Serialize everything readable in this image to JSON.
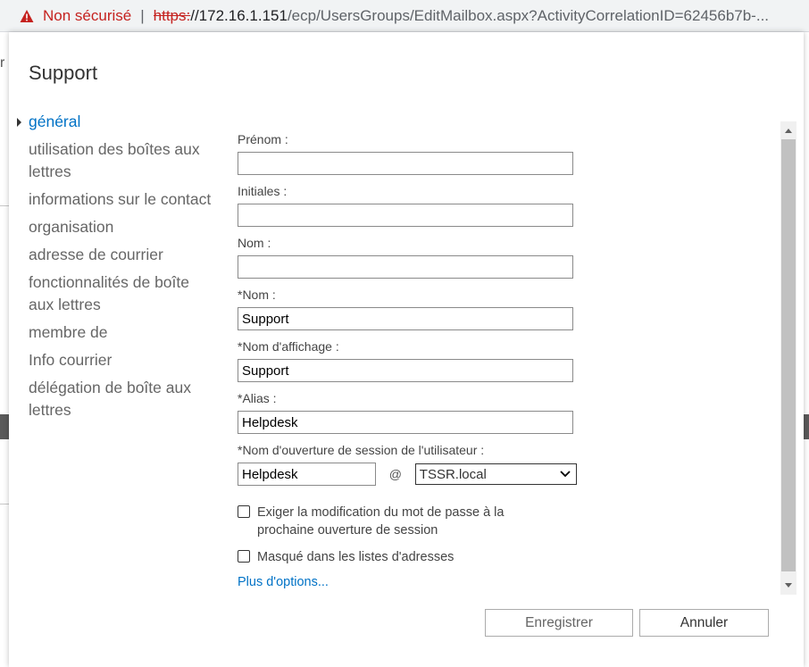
{
  "browser": {
    "security_warning": "Non sécurisé",
    "separator": "|",
    "url_scheme": "https:",
    "url_host": "//172.16.1.151",
    "url_path": "/ecp/UsersGroups/EditMailbox.aspx?ActivityCorrelationID=62456b7b-..."
  },
  "background": {
    "partial_char": "r"
  },
  "dialog": {
    "title": "Support",
    "nav": [
      {
        "label": "général",
        "active": true
      },
      {
        "label": "utilisation des boîtes aux lettres"
      },
      {
        "label": "informations sur le contact"
      },
      {
        "label": "organisation"
      },
      {
        "label": "adresse de courrier"
      },
      {
        "label": "fonctionnalités de boîte aux lettres"
      },
      {
        "label": "membre de"
      },
      {
        "label": "Info courrier"
      },
      {
        "label": "délégation de boîte aux lettres"
      }
    ],
    "form": {
      "first_name": {
        "label": "Prénom :",
        "value": ""
      },
      "initials": {
        "label": "Initiales :",
        "value": ""
      },
      "last_name": {
        "label": "Nom :",
        "value": ""
      },
      "name": {
        "label": "*Nom :",
        "value": "Support"
      },
      "display_name": {
        "label": "*Nom d'affichage :",
        "value": "Support"
      },
      "alias": {
        "label": "*Alias :",
        "value": "Helpdesk"
      },
      "logon": {
        "label": "*Nom d'ouverture de session de l'utilisateur :",
        "value": "Helpdesk",
        "at": "@",
        "domain": "TSSR.local"
      },
      "require_password_change": {
        "label": "Exiger la modification du mot de passe à la prochaine ouverture de session",
        "checked": false
      },
      "hidden_from_address_lists": {
        "label": "Masqué dans les listes d'adresses",
        "checked": false
      },
      "more_options": "Plus d'options..."
    },
    "buttons": {
      "save": "Enregistrer",
      "cancel": "Annuler"
    }
  }
}
